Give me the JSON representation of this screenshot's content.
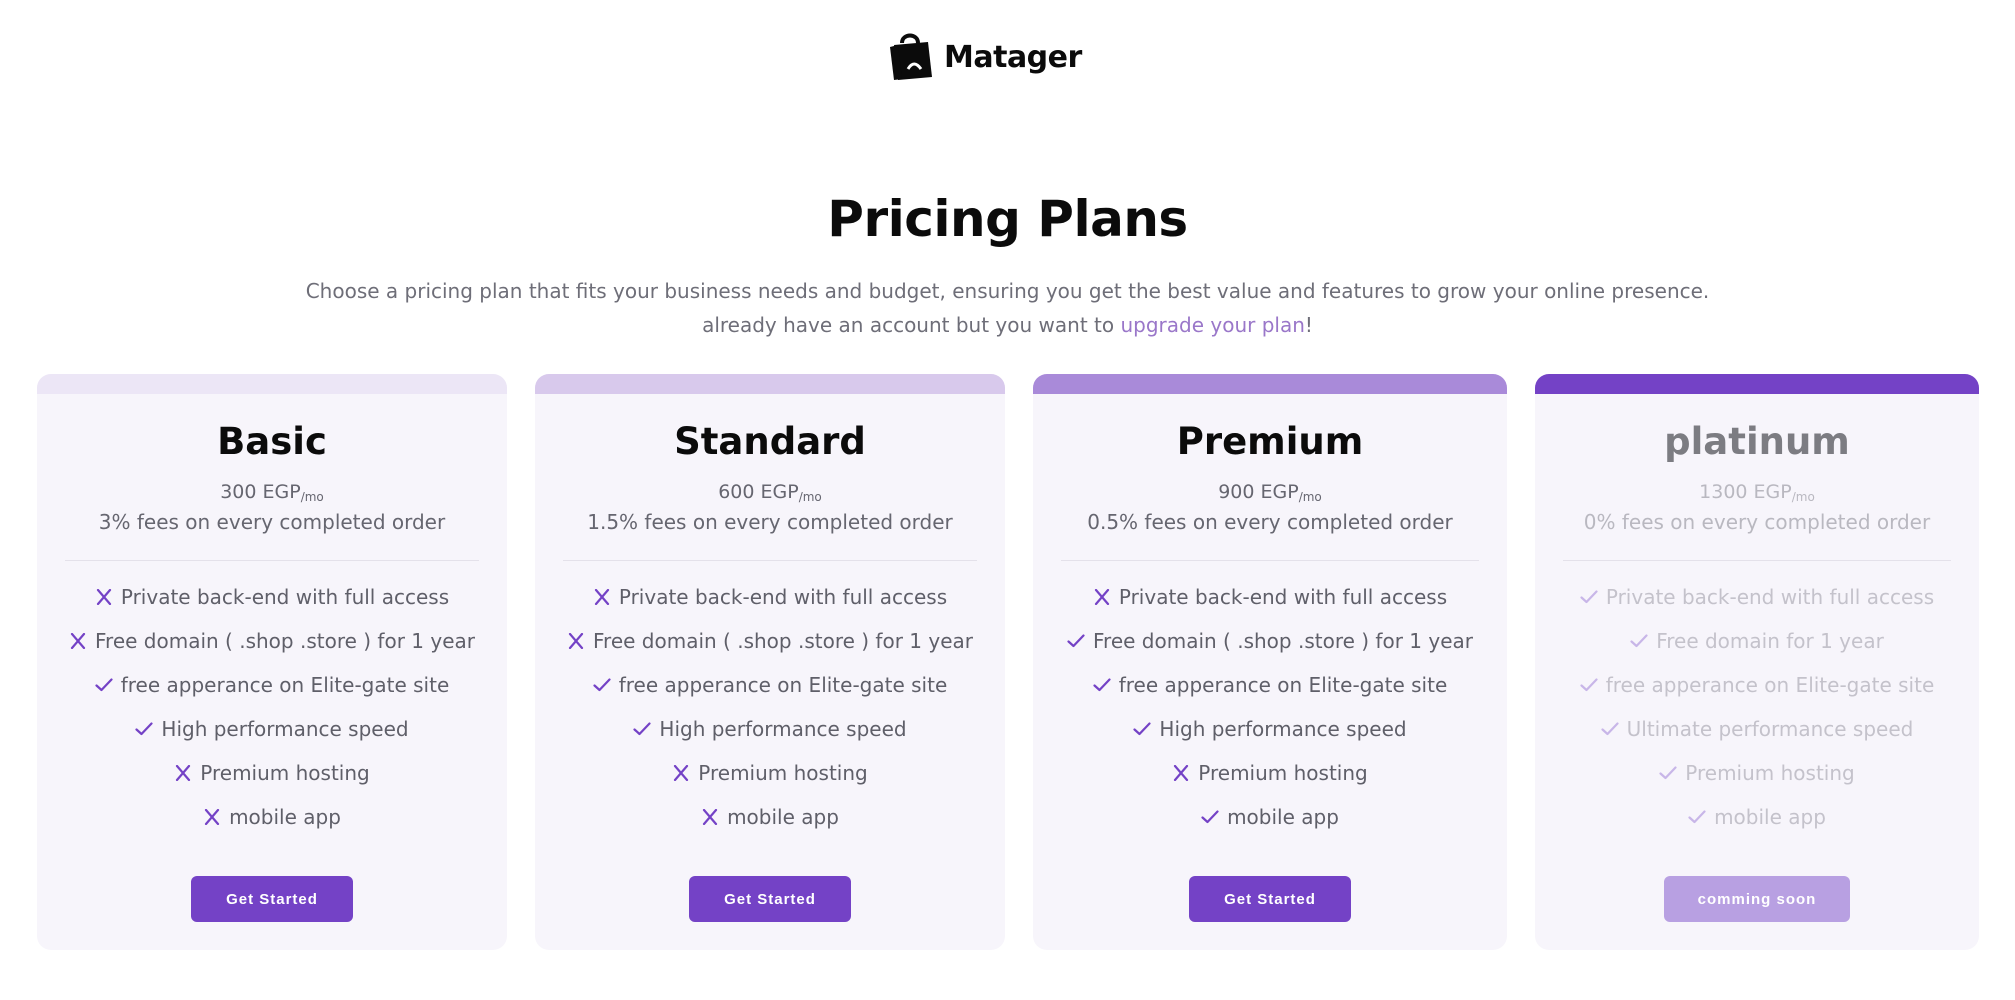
{
  "brand": {
    "name": "Matager",
    "logo_icon": "shopping-bag-icon"
  },
  "header": {
    "title": "Pricing Plans",
    "subtitle_line1": "Choose a pricing plan that fits your business needs and budget, ensuring you get the best value and features to grow your online presence.",
    "subtitle_line2_prefix": "already have an account but you want to ",
    "subtitle_link": "upgrade your plan",
    "subtitle_line2_suffix": "!"
  },
  "colors": {
    "accent": "#7442c6",
    "link": "#9a77c9",
    "card_bg": "#f7f5fb",
    "band_basic": "#ece6f6",
    "band_standard": "#d8c9ec",
    "band_premium": "#a98ad9",
    "band_platinum": "#7442c6",
    "button_disabled": "#b8a0e2"
  },
  "plans": [
    {
      "name": "Basic",
      "price": "300 EGP",
      "per": "/mo",
      "fees": "3% fees on every completed order",
      "features": [
        {
          "icon": "x-icon",
          "text": "Private back-end with full access"
        },
        {
          "icon": "x-icon",
          "text": "Free domain ( .shop .store ) for 1 year"
        },
        {
          "icon": "check-icon",
          "text": "free apperance on Elite-gate site"
        },
        {
          "icon": "check-icon",
          "text": "High performance speed"
        },
        {
          "icon": "x-icon",
          "text": "Premium hosting"
        },
        {
          "icon": "x-icon",
          "text": "mobile app"
        }
      ],
      "button": "Get Started"
    },
    {
      "name": "Standard",
      "price": "600 EGP",
      "per": "/mo",
      "fees": "1.5% fees on every completed order",
      "features": [
        {
          "icon": "x-icon",
          "text": "Private back-end with full access"
        },
        {
          "icon": "x-icon",
          "text": "Free domain ( .shop .store ) for 1 year"
        },
        {
          "icon": "check-icon",
          "text": "free apperance on Elite-gate site"
        },
        {
          "icon": "check-icon",
          "text": "High performance speed"
        },
        {
          "icon": "x-icon",
          "text": "Premium hosting"
        },
        {
          "icon": "x-icon",
          "text": "mobile app"
        }
      ],
      "button": "Get Started"
    },
    {
      "name": "Premium",
      "price": "900 EGP",
      "per": "/mo",
      "fees": "0.5% fees on every completed order",
      "features": [
        {
          "icon": "x-icon",
          "text": "Private back-end with full access"
        },
        {
          "icon": "check-icon",
          "text": "Free domain ( .shop .store ) for 1 year"
        },
        {
          "icon": "check-icon",
          "text": "free apperance on Elite-gate site"
        },
        {
          "icon": "check-icon",
          "text": "High performance speed"
        },
        {
          "icon": "x-icon",
          "text": "Premium hosting"
        },
        {
          "icon": "check-icon",
          "text": "mobile app"
        }
      ],
      "button": "Get Started"
    },
    {
      "name": "platinum",
      "price": "1300 EGP",
      "per": "/mo",
      "fees": "0% fees on every completed order",
      "features": [
        {
          "icon": "check-icon",
          "text": "Private back-end with full access"
        },
        {
          "icon": "check-icon",
          "text": "Free domain for 1 year"
        },
        {
          "icon": "check-icon",
          "text": "free apperance on Elite-gate site"
        },
        {
          "icon": "check-icon",
          "text": "Ultimate performance speed"
        },
        {
          "icon": "check-icon",
          "text": "Premium hosting"
        },
        {
          "icon": "check-icon",
          "text": "mobile app"
        }
      ],
      "button": "comming soon"
    }
  ]
}
